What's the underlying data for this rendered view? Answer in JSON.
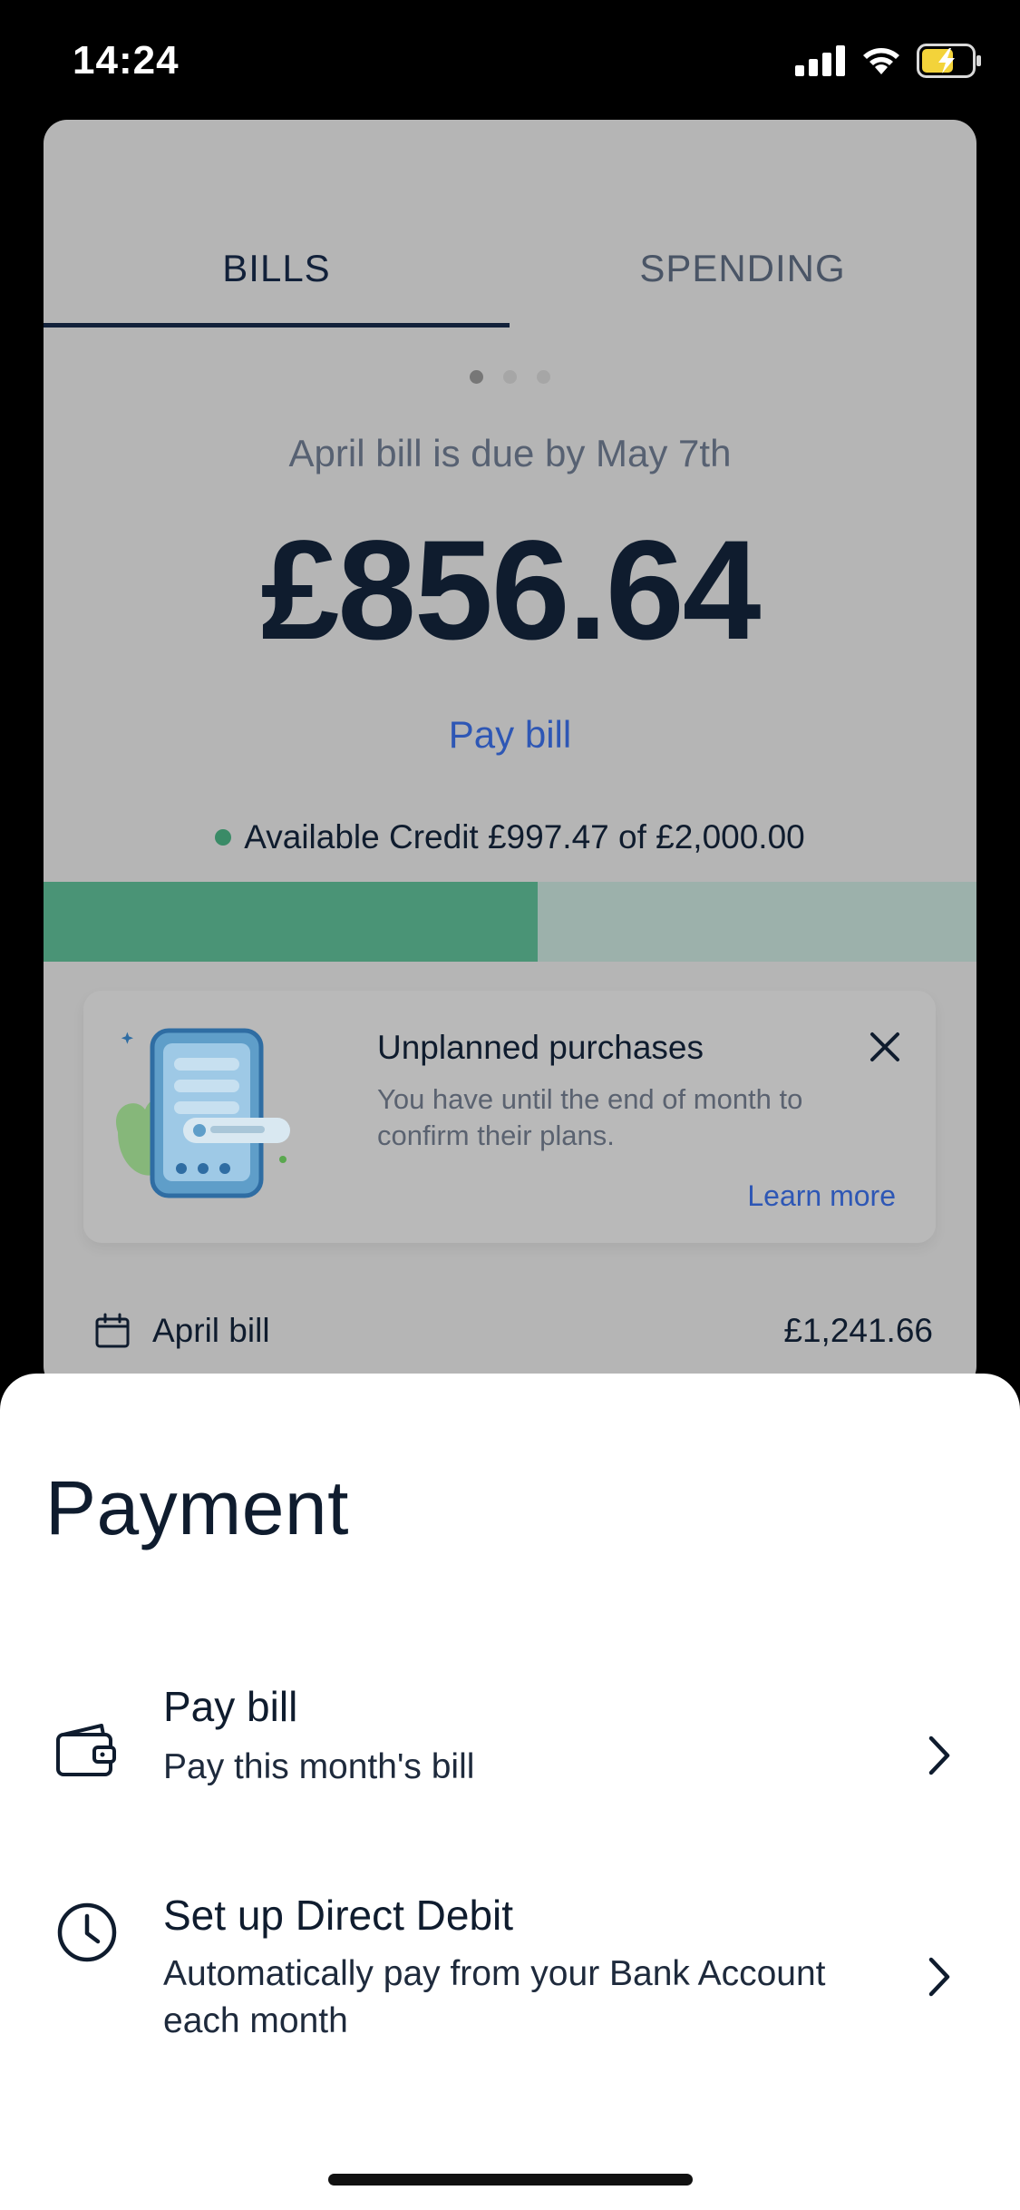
{
  "status_bar": {
    "time": "14:24"
  },
  "tabs": [
    {
      "label": "BILLS",
      "active": true
    },
    {
      "label": "SPENDING",
      "active": false
    }
  ],
  "pager": {
    "count": 3,
    "active_index": 0
  },
  "bill": {
    "due_text": "April bill is due by May 7th",
    "amount": "£856.64",
    "pay_link": "Pay bill"
  },
  "credit": {
    "text": "Available Credit £997.47 of £2,000.00",
    "available": 997.47,
    "limit": 2000.0,
    "fill_fraction": 0.53
  },
  "banner": {
    "title": "Unplanned purchases",
    "body": "You have until the end of month to confirm their plans.",
    "link": "Learn more"
  },
  "bill_row": {
    "label": "April bill",
    "amount": "£1,241.66"
  },
  "sheet": {
    "title": "Payment",
    "options": [
      {
        "title": "Pay bill",
        "subtitle": "Pay this month's bill",
        "icon": "wallet-icon"
      },
      {
        "title": "Set up Direct Debit",
        "subtitle": "Automatically pay from your Bank Account each month",
        "icon": "clock-icon"
      }
    ]
  },
  "colors": {
    "primary_text": "#0f1c2e",
    "link_blue": "#2e57b5",
    "credit_green": "#4a9476",
    "overlay_card": "#b5b5b5"
  }
}
